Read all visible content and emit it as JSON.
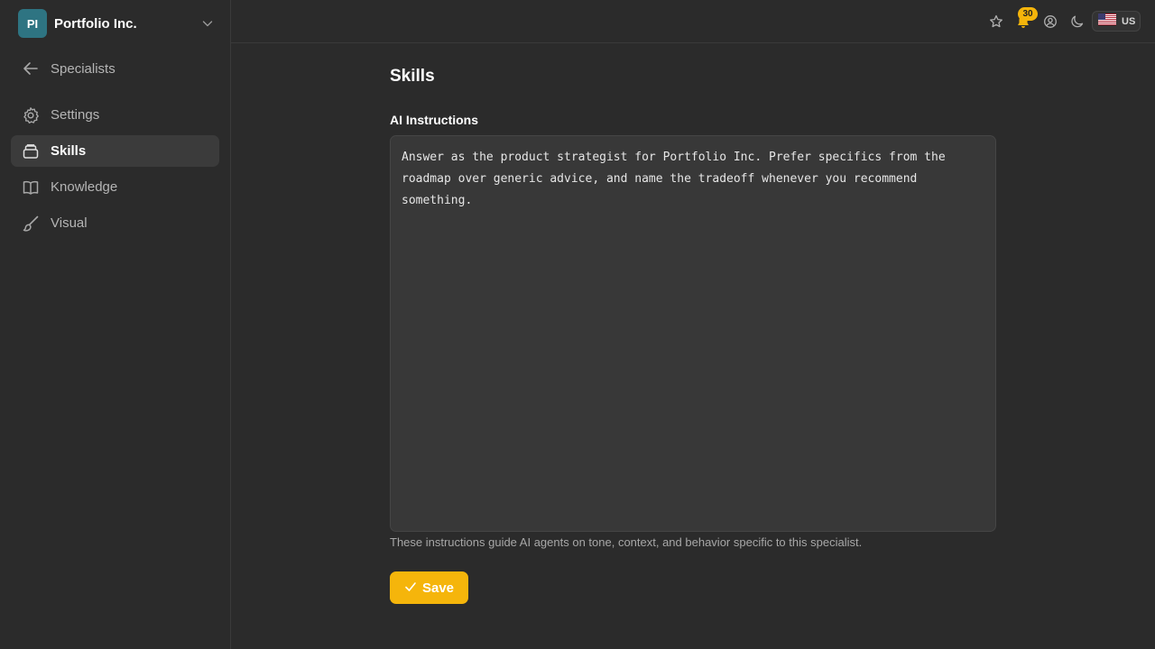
{
  "org": {
    "initials": "PI",
    "name": "Portfolio Inc."
  },
  "nav": {
    "back_label": "Specialists",
    "items": [
      {
        "label": "Settings",
        "icon": "gear-icon"
      },
      {
        "label": "Skills",
        "icon": "inbox-icon",
        "active": true
      },
      {
        "label": "Knowledge",
        "icon": "book-icon"
      },
      {
        "label": "Visual",
        "icon": "paintbrush-icon"
      }
    ]
  },
  "topbar": {
    "notification_count": "30",
    "locale": "US",
    "icons": [
      "star-icon",
      "bell-icon",
      "user-circle-icon",
      "moon-icon",
      "us-flag-icon"
    ]
  },
  "main": {
    "title": "Skills",
    "field_label": "AI Instructions",
    "instructions": "Answer as the product strategist for Portfolio Inc. Prefer specifics from the roadmap over generic advice, and name the tradeoff whenever you recommend something.",
    "helper_text": "These instructions guide AI agents on tone, context, and behavior specific to this specialist.",
    "save_label": "Save"
  },
  "colors": {
    "accent": "#f5b50b",
    "avatar": "#2e7482",
    "background": "#2b2b2b"
  }
}
